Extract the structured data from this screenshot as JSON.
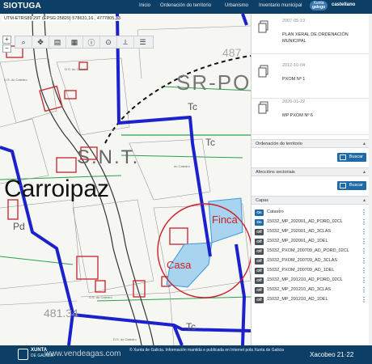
{
  "app": {
    "brand": "SIOTUGA"
  },
  "nav": {
    "items": [
      "Inicio",
      "Ordenación do territorio",
      "Urbanismo",
      "Inventario municipal"
    ],
    "lang_badge_top": "Xunta",
    "lang_badge_bottom": "galego",
    "lang_other": "castellano"
  },
  "map": {
    "coords": "UTM-ETRS89 29T (EPSG:25829) 578631,16 , 4777805,33",
    "toolbar_icons": [
      "search-icon",
      "move-icon",
      "layers-icon",
      "map-icon",
      "info-icon",
      "location-icon",
      "measure-icon",
      "legend-icon"
    ],
    "labels": {
      "place": "Carroipaz",
      "finca": "Finca",
      "casa": "Casa",
      "snt": "S.N.T.",
      "srpo": "SR-PO",
      "elev1": "487",
      "elev2": "481.34",
      "tc": "Tc",
      "pd": "Pd"
    }
  },
  "panel": {
    "plans": [
      {
        "date": "2007-05-19",
        "title": "PLAN XERAL DE ORDENACIÓN MUNICIPAL"
      },
      {
        "date": "2012-10-04",
        "title": "PXOM Nº 1"
      },
      {
        "date": "2020-01-22",
        "title": "MP PXOM Nº 6"
      }
    ],
    "sections": {
      "ordenacion": "Ordenación do territorio",
      "afeccions": "Afeccións sectoriais",
      "capas": "Capas"
    },
    "buscar": "Buscar",
    "layers": [
      {
        "tag": "On",
        "name": "Catastro"
      },
      {
        "tag": "On",
        "name": "15032_MP_202001_AD_PORD_02CL"
      },
      {
        "tag": "Off",
        "name": "15032_MP_202001_AD_3CLAS"
      },
      {
        "tag": "Off",
        "name": "15032_MP_202001_AD_1DEL"
      },
      {
        "tag": "Off",
        "name": "15032_PXOM_200709_AD_PORD_02CL"
      },
      {
        "tag": "Off",
        "name": "15032_PXOM_200709_AD_3CLAS"
      },
      {
        "tag": "Off",
        "name": "15032_PXOM_200709_AD_1DEL"
      },
      {
        "tag": "Off",
        "name": "15032_MP_201210_AD_PORD_02CL"
      },
      {
        "tag": "Off",
        "name": "15032_MP_201210_AD_3CLAS"
      },
      {
        "tag": "Off",
        "name": "15032_MP_201210_AD_1DEL"
      }
    ]
  },
  "footer": {
    "xunta": "XUNTA",
    "xunta2": "DE GALICIA",
    "notice": "© Xunta de Galicia. Información mantida e publicada en Internet pola Xunta de Galicia",
    "xacobeo": "Xacobeo 21·22",
    "watermark": "www.vendeagas.com"
  },
  "colors": {
    "navbar": "#0d3f66",
    "accent": "#1f6aa8",
    "boundary": "#1b22cc",
    "annotation": "#c8202a",
    "parcel": "#a9d4ef"
  }
}
